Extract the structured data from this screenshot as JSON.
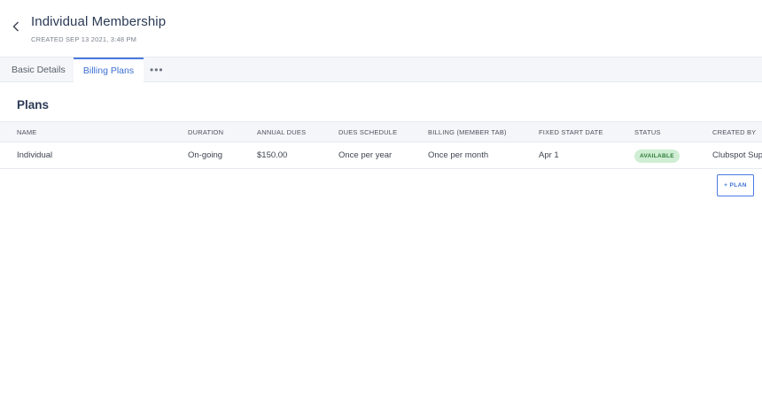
{
  "header": {
    "title": "Individual Membership",
    "subtitle": "CREATED SEP 13 2021, 3:48 PM",
    "back_icon": "chevron-left-icon"
  },
  "tabs": [
    {
      "label": "Basic Details",
      "active": false
    },
    {
      "label": "Billing Plans",
      "active": true
    },
    {
      "label": "•••",
      "active": false
    }
  ],
  "section": {
    "title": "Plans"
  },
  "table": {
    "columns": [
      "NAME",
      "DURATION",
      "ANNUAL DUES",
      "DUES SCHEDULE",
      "BILLING (MEMBER TAB)",
      "FIXED START DATE",
      "STATUS",
      "CREATED BY"
    ],
    "rows": [
      {
        "name": "Individual",
        "duration": "On-going",
        "annual_dues": "$150.00",
        "dues_schedule": "Once per year",
        "billing": "Once per month",
        "fixed_start_date": "Apr 1",
        "status": "AVAILABLE",
        "created_by": "Clubspot Sup"
      }
    ]
  },
  "actions": {
    "add_plan_label": "+ PLAN"
  },
  "colors": {
    "accent": "#4a7ae0",
    "status_bg": "#cfeed3",
    "status_text": "#2e7d3b"
  }
}
